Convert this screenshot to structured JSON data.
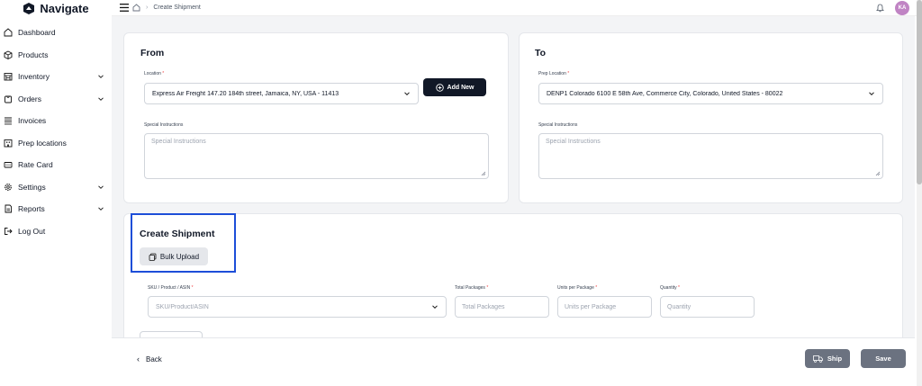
{
  "app": {
    "name": "Navigate"
  },
  "sidebar": {
    "items": [
      {
        "label": "Dashboard",
        "icon": "home-icon",
        "expandable": false
      },
      {
        "label": "Products",
        "icon": "box-icon",
        "expandable": false
      },
      {
        "label": "Inventory",
        "icon": "warehouse-icon",
        "expandable": true
      },
      {
        "label": "Orders",
        "icon": "cart-icon",
        "expandable": true
      },
      {
        "label": "Invoices",
        "icon": "list-icon",
        "expandable": false
      },
      {
        "label": "Prep locations",
        "icon": "building-icon",
        "expandable": false
      },
      {
        "label": "Rate Card",
        "icon": "card-icon",
        "expandable": false
      },
      {
        "label": "Settings",
        "icon": "gear-icon",
        "expandable": true
      },
      {
        "label": "Reports",
        "icon": "report-icon",
        "expandable": true
      },
      {
        "label": "Log Out",
        "icon": "logout-icon",
        "expandable": false
      }
    ]
  },
  "topbar": {
    "breadcrumb_page": "Create Shipment",
    "avatar_initials": "KA"
  },
  "from": {
    "title": "From",
    "location_label": "Location",
    "location_value": "Express Air Freight 147.20 184th street, Jamaica, NY, USA - 11413",
    "add_new_label": "Add New",
    "instructions_label": "Special Instructions",
    "instructions_placeholder": "Special Instructions"
  },
  "to": {
    "title": "To",
    "prep_label": "Prep Location",
    "prep_value": "DENP1 Colorado 6100 E 58th Ave, Commerce City, Colorado, United States - 80022",
    "instructions_label": "Special Instructions",
    "instructions_placeholder": "Special Instructions"
  },
  "shipment": {
    "title": "Create Shipment",
    "bulk_upload_label": "Bulk Upload",
    "sku_label": "SKU / Product / ASIN",
    "sku_placeholder": "SKU/Product/ASIN",
    "total_packages_label": "Total Packages",
    "total_packages_placeholder": "Total Packages",
    "units_label": "Units per Package",
    "units_placeholder": "Units per Package",
    "quantity_label": "Quantity",
    "quantity_placeholder": "Quantity"
  },
  "footer": {
    "back_label": "Back",
    "ship_label": "Ship",
    "save_label": "Save"
  },
  "colors": {
    "highlight": "#1d4ed8",
    "dark_button": "#111827",
    "action_button": "#6b7280",
    "required": "#ef4444"
  }
}
